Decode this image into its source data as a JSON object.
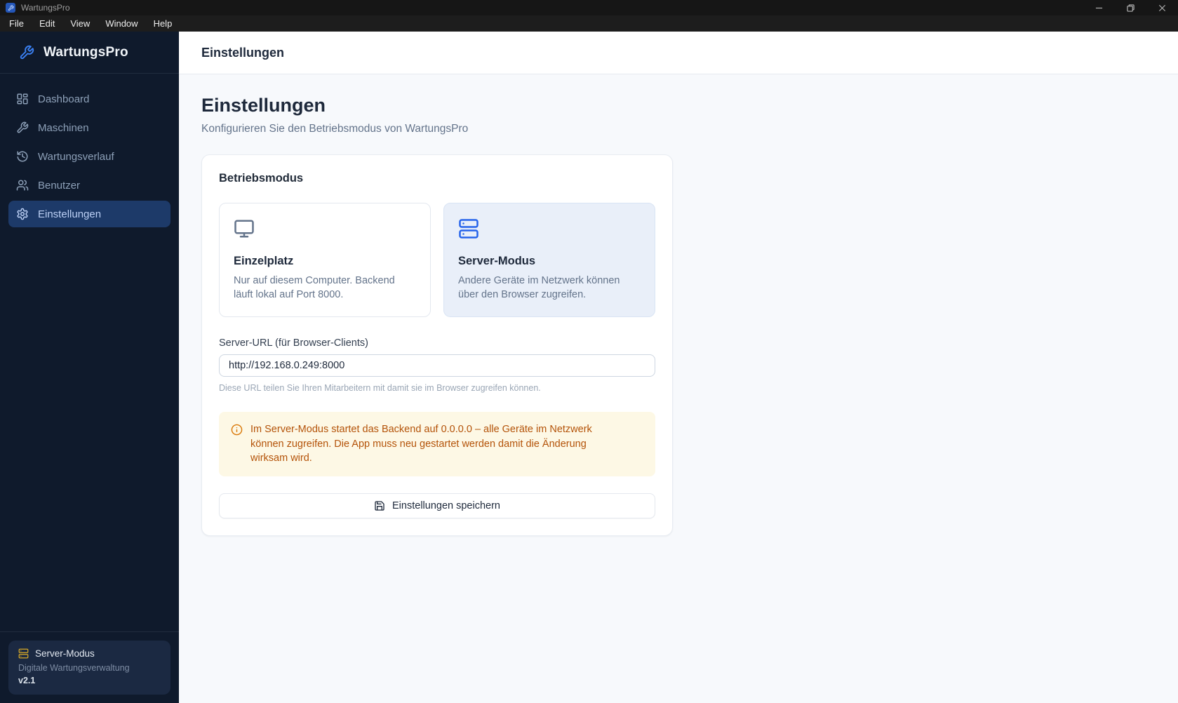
{
  "titlebar": {
    "app_title": "WartungsPro"
  },
  "menubar": {
    "items": [
      "File",
      "Edit",
      "View",
      "Window",
      "Help"
    ]
  },
  "sidebar": {
    "logo_text": "WartungsPro",
    "items": [
      {
        "label": "Dashboard",
        "icon": "dashboard-icon",
        "active": false
      },
      {
        "label": "Maschinen",
        "icon": "wrench-icon",
        "active": false
      },
      {
        "label": "Wartungsverlauf",
        "icon": "history-icon",
        "active": false
      },
      {
        "label": "Benutzer",
        "icon": "users-icon",
        "active": false
      },
      {
        "label": "Einstellungen",
        "icon": "gear-icon",
        "active": true
      }
    ],
    "footer": {
      "mode": "Server-Modus",
      "subtitle": "Digitale Wartungsverwaltung",
      "version": "v2.1"
    }
  },
  "header": {
    "title": "Einstellungen"
  },
  "page": {
    "title": "Einstellungen",
    "subtitle": "Konfigurieren Sie den Betriebsmodus von WartungsPro"
  },
  "card": {
    "section_title": "Betriebsmodus",
    "modes": [
      {
        "title": "Einzelplatz",
        "description": "Nur auf diesem Computer. Backend läuft lokal auf Port 8000.",
        "icon": "monitor-icon",
        "selected": false
      },
      {
        "title": "Server-Modus",
        "description": "Andere Geräte im Netzwerk können über den Browser zugreifen.",
        "icon": "server-icon",
        "selected": true
      }
    ],
    "url_field": {
      "label": "Server-URL (für Browser-Clients)",
      "value": "http://192.168.0.249:8000",
      "helper": "Diese URL teilen Sie Ihren Mitarbeitern mit damit sie im Browser zugreifen können."
    },
    "warning": "Im Server-Modus startet das Backend auf 0.0.0.0 – alle Geräte im Netzwerk können zugreifen. Die App muss neu gestartet werden damit die Änderung wirksam wird.",
    "save_button": "Einstellungen speichern"
  },
  "colors": {
    "accent_blue": "#2563eb",
    "sidebar_bg": "#0f1a2c",
    "active_nav_bg": "#1d3a69",
    "selected_mode_bg": "#e9eff9",
    "warning_bg": "#fdf8e5",
    "warning_text": "#b45309",
    "footer_amber": "#d8a927"
  }
}
